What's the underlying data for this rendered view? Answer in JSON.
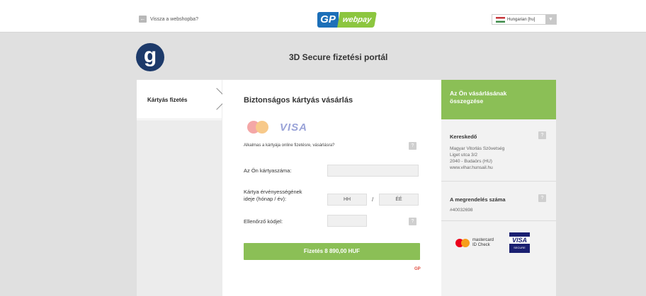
{
  "header": {
    "back_label": "Vissza a webshopba?",
    "logo_left": "GP",
    "logo_right": "webpay",
    "language": "Hungarian [hu]"
  },
  "portal": {
    "logo_letter": "g",
    "title": "3D Secure fizetési portál"
  },
  "steps": {
    "active": "Kártyás fizetés"
  },
  "form": {
    "title": "Biztonságos kártyás vásárlás",
    "visa_text": "VISA",
    "suitable_text": "Alkalmas a kártyája online fizetésre, vásárlásra?",
    "help": "?",
    "card_number_label": "Az Ön kártyaszáma:",
    "card_number_value": "",
    "expiry_label_1": "Kártya érvényességének",
    "expiry_label_2": "ideje (hónap / év):",
    "month_placeholder": "HH",
    "year_placeholder": "ÉÉ",
    "slash": "/",
    "cvc_label": "Ellenőrző kódjel:",
    "cvc_value": "",
    "pay_button": "Fizetés 8 890,00 HUF",
    "gp_mark": "GP"
  },
  "summary": {
    "heading_1": "Az Ön vásárlásának",
    "heading_2": "összegzése",
    "merchant_title": "Kereskedő",
    "merchant_lines": [
      "Magyar Vitorlás Szövetség",
      "Liget utca 3/2",
      "2040 - Budaörs (HU)",
      "www.vihar.hunsail.hu"
    ],
    "order_title": "A megrendelés száma",
    "order_number": "#40032698",
    "mc_line1": "mastercard",
    "mc_line2": "ID Check",
    "visa_secure_1": "VISA",
    "visa_secure_2": "SECURE"
  },
  "colors": {
    "accent_green": "#8bbf56",
    "brand_blue": "#1c6fb8",
    "gp_red": "#e04a3c"
  }
}
